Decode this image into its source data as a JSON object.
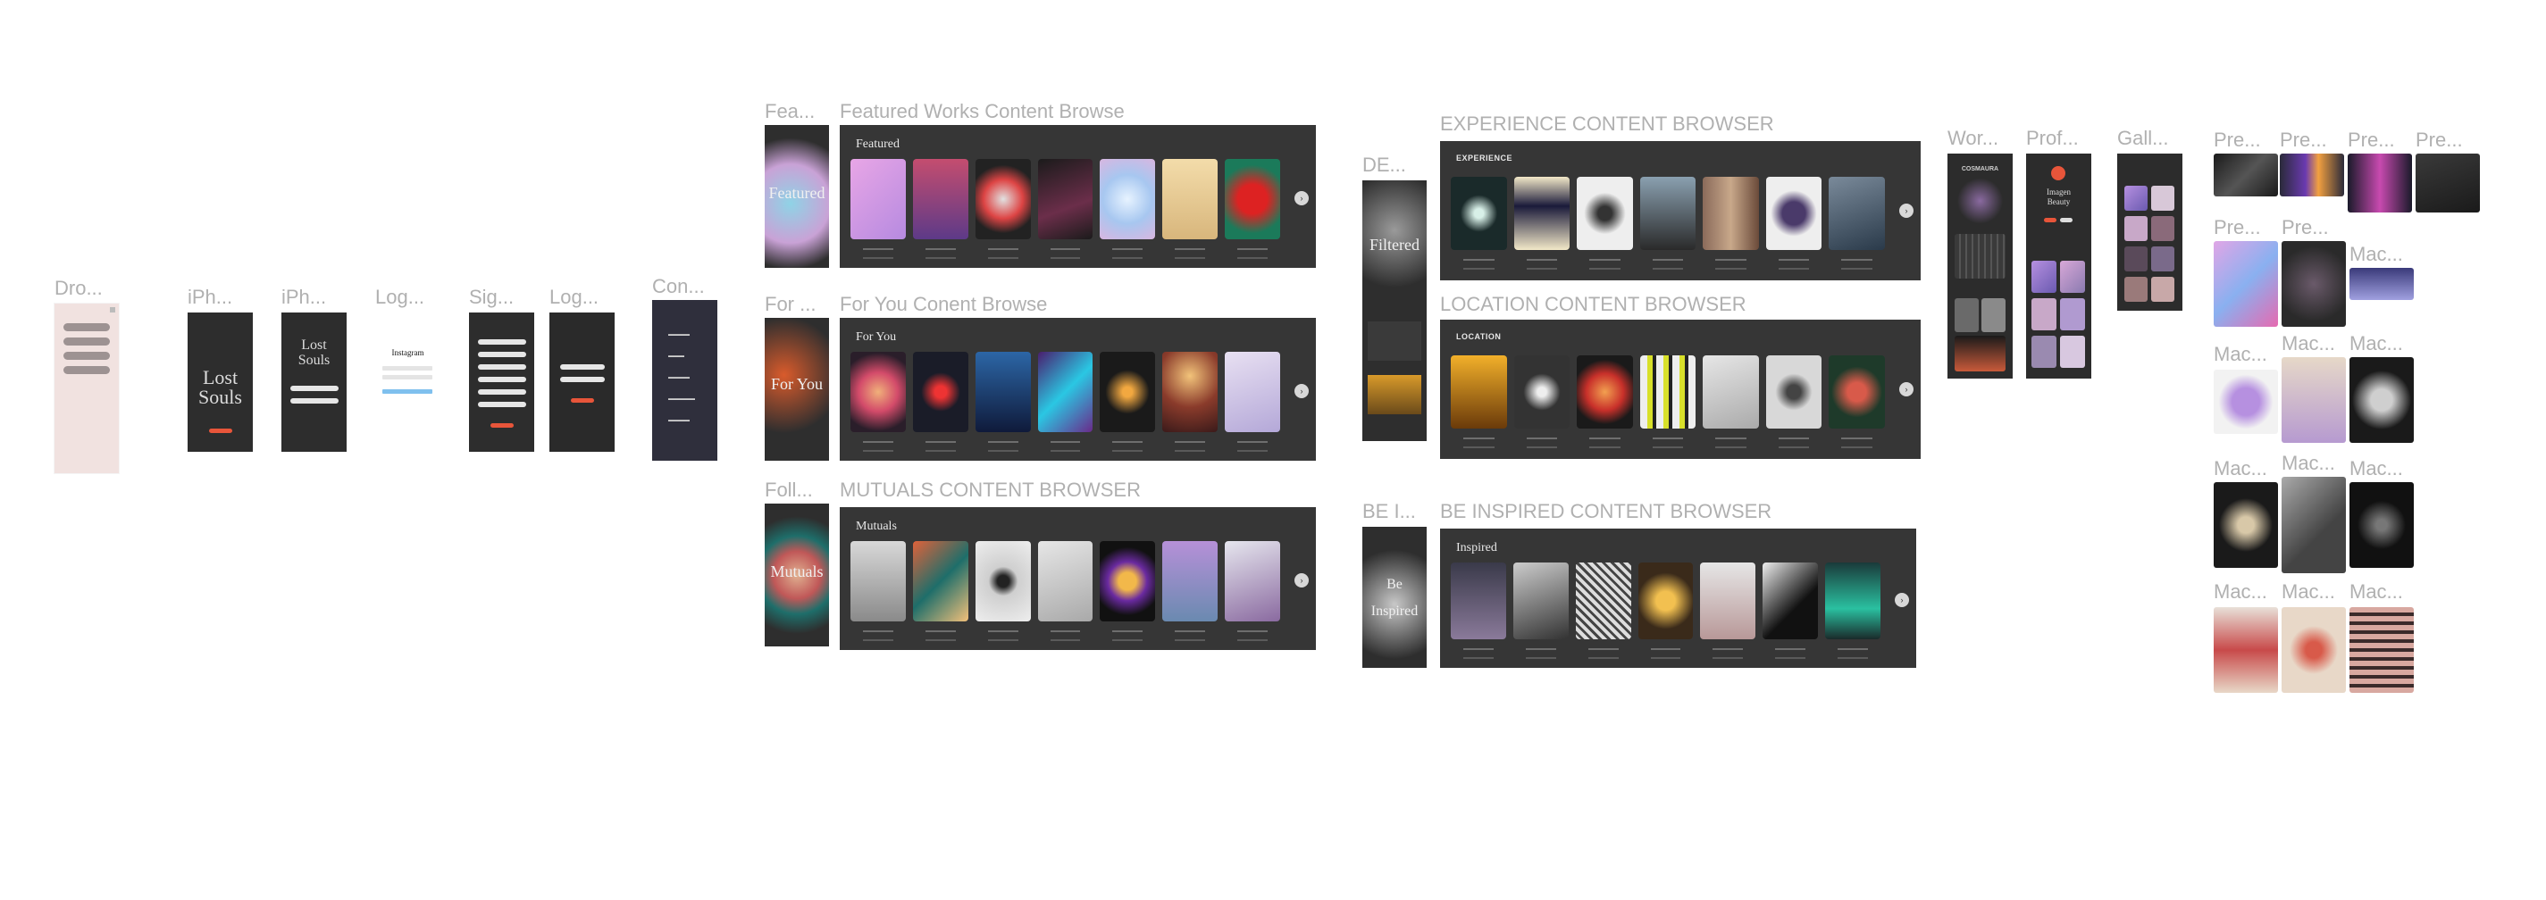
{
  "canvas": {
    "background": "#ffffff"
  },
  "frames": {
    "dropdown": {
      "label": "Dro...",
      "options": [
        "",
        "",
        "",
        ""
      ]
    },
    "iphone1": {
      "label": "iPh...",
      "title": "Lost Souls"
    },
    "iphone2": {
      "label": "iPh...",
      "title": "Lost Souls"
    },
    "login1": {
      "label": "Log...",
      "brand": "Instagram"
    },
    "signup": {
      "label": "Sig..."
    },
    "login2": {
      "label": "Log..."
    },
    "content": {
      "label": "Con..."
    },
    "featured_side": {
      "label": "Fea...",
      "title": "Featured"
    },
    "foryou_side": {
      "label": "For ...",
      "title": "For You"
    },
    "mutuals_side": {
      "label": "Foll...",
      "title": "Mutuals"
    },
    "filtered_side": {
      "label": "DE...",
      "title": "Filtered"
    },
    "inspired_side": {
      "label": "BE I...",
      "title": "Be Inspired"
    },
    "works": {
      "label": "Wor...",
      "title": "COSMAURA"
    },
    "profile": {
      "label": "Prof...",
      "title": "Imagen Beauty"
    },
    "gallery": {
      "label": "Gall..."
    }
  },
  "browsers": {
    "featured": {
      "label": "Featured Works Content Browse",
      "title": "Featured"
    },
    "foryou": {
      "label": "For You Conent Browse",
      "title": "For You"
    },
    "mutuals": {
      "label": "MUTUALS CONTENT BROWSER",
      "title": "Mutuals"
    },
    "experience": {
      "label": "EXPERIENCE CONTENT BROWSER",
      "title": "EXPERIENCE"
    },
    "location": {
      "label": "LOCATION CONTENT BROWSER",
      "title": "LOCATION"
    },
    "inspired": {
      "label": "BE INSPIRED CONTENT BROWSER",
      "title": "Inspired"
    }
  },
  "right_grid_labels": {
    "pre1": "Pre...",
    "pre2": "Pre...",
    "pre3": "Pre...",
    "pre4": "Pre...",
    "pre5": "Pre...",
    "pre6": "Pre...",
    "mac1": "Mac...",
    "mac2": "Mac...",
    "mac3": "Mac...",
    "mac4": "Mac...",
    "mac5": "Mac...",
    "mac6": "Mac...",
    "mac7": "Mac...",
    "mac8": "Mac...",
    "mac9": "Mac...",
    "mac10": "Mac..."
  },
  "icons": {
    "next": "chevron-right-icon"
  },
  "colors": {
    "label": "#b0b0b0",
    "frame": "#363636",
    "accent": "#e8553a"
  }
}
